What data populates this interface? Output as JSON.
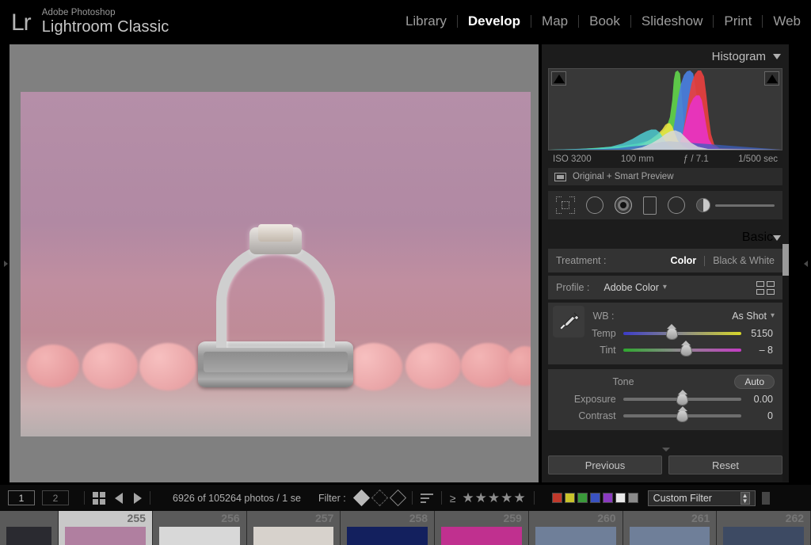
{
  "app": {
    "logo": "Lr",
    "brand_sup": "Adobe Photoshop",
    "brand_main": "Lightroom Classic"
  },
  "modules": [
    {
      "label": "Library",
      "active": false
    },
    {
      "label": "Develop",
      "active": true
    },
    {
      "label": "Map",
      "active": false
    },
    {
      "label": "Book",
      "active": false
    },
    {
      "label": "Slideshow",
      "active": false
    },
    {
      "label": "Print",
      "active": false
    },
    {
      "label": "Web",
      "active": false
    }
  ],
  "histogram": {
    "title": "Histogram",
    "exif": {
      "iso": "ISO 3200",
      "focal": "100 mm",
      "aperture": "ƒ / 7.1",
      "shutter": "1/500 sec"
    },
    "smart_preview": "Original + Smart Preview"
  },
  "toolstrip": {
    "tools": [
      "crop-overlay",
      "spot-removal",
      "red-eye",
      "graduated-filter",
      "radial-filter",
      "adjustment-brush"
    ],
    "brush_size": 10
  },
  "basic": {
    "title": "Basic",
    "treatment_label": "Treatment :",
    "treatment_color": "Color",
    "treatment_bw": "Black & White",
    "treatment_selected": "Color",
    "profile_label": "Profile :",
    "profile_value": "Adobe Color",
    "wb_label": "WB :",
    "wb_value": "As Shot",
    "temp_label": "Temp",
    "temp_value": "5150",
    "tint_label": "Tint",
    "tint_value": "– 8",
    "tone_label": "Tone",
    "auto_label": "Auto",
    "exposure_label": "Exposure",
    "exposure_value": "0.00",
    "contrast_label": "Contrast",
    "contrast_value": "0"
  },
  "panel_buttons": {
    "previous": "Previous",
    "reset": "Reset"
  },
  "toolbar": {
    "page1": "1",
    "page2": "2",
    "counter": "6926 of 105264 photos / 1 se",
    "filter_label": "Filter :",
    "rating_gte": "≥",
    "stars": [
      "★",
      "★",
      "★",
      "★",
      "★"
    ],
    "swatches": [
      "#c0392b",
      "#c9c32b",
      "#3a9a3a",
      "#3a52c0",
      "#8a3ac0",
      "#e8e8e8",
      "#8a8a8a"
    ],
    "custom_filter": "Custom Filter"
  },
  "filmstrip": {
    "cells": [
      {
        "num": "",
        "selected": false,
        "color": "#2a2a30",
        "partial": true
      },
      {
        "num": "255",
        "selected": true,
        "color": "#b07fa0",
        "partial": false
      },
      {
        "num": "256",
        "selected": false,
        "color": "#d8d8d8",
        "partial": false
      },
      {
        "num": "257",
        "selected": false,
        "color": "#d7d2cc",
        "partial": false
      },
      {
        "num": "258",
        "selected": false,
        "color": "#13205e",
        "partial": false
      },
      {
        "num": "259",
        "selected": false,
        "color": "#c0308f",
        "partial": false
      },
      {
        "num": "260",
        "selected": false,
        "color": "#6f7f99",
        "partial": false
      },
      {
        "num": "261",
        "selected": false,
        "color": "#6f7f99",
        "partial": false
      },
      {
        "num": "262",
        "selected": false,
        "color": "#3d4a63",
        "partial": false
      }
    ]
  },
  "photo": {
    "subject": "diamond-engagement-ring-on-wedding-band-with-pink-candies",
    "background_color": "#b58fa8",
    "canvas_color": "#808080"
  }
}
